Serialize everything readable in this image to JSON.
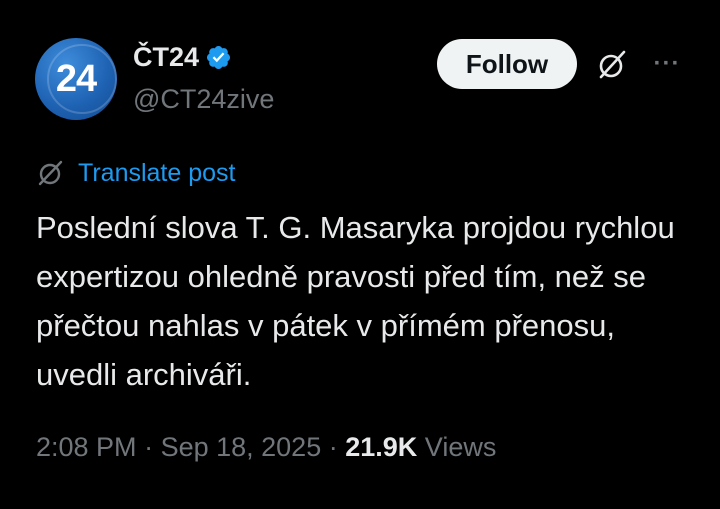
{
  "account": {
    "avatar_text": "24",
    "display_name": "ČT24",
    "handle": "@CT24zive",
    "verified_color": "#1d9bf0"
  },
  "actions": {
    "follow_label": "Follow",
    "grok_icon": "grok-icon",
    "more_icon": "more-horizontal-icon",
    "more_glyph": "···"
  },
  "translate": {
    "label": "Translate post"
  },
  "post": {
    "text": "Poslední slova T. G. Masaryka projdou rychlou expertizou ohledně pravosti před tím, než se přečtou nahlas v pátek v přímém přenosu, uvedli archiváři."
  },
  "meta": {
    "time": "2:08 PM",
    "separator": " · ",
    "date": "Sep 18, 2025",
    "views_count": "21.9K",
    "views_label": "Views"
  },
  "colors": {
    "background": "#000000",
    "text_primary": "#e7e9ea",
    "text_secondary": "#71767b",
    "link": "#1d9bf0",
    "button_bg": "#eff3f4"
  }
}
